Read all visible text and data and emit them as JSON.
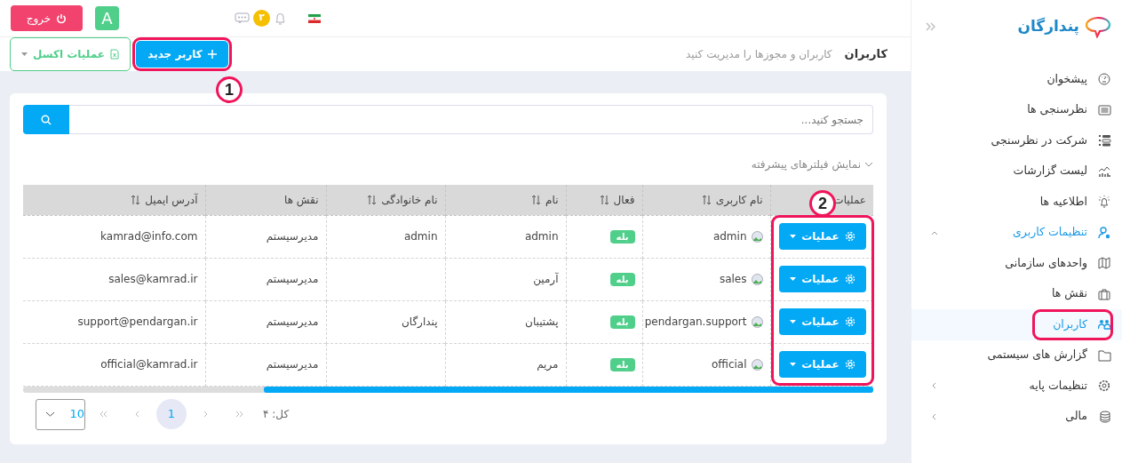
{
  "topbar": {
    "logout": "خروج",
    "avatar": "A",
    "notification_count": "۲"
  },
  "header": {
    "title": "کاربران",
    "subtitle": "کاربران و مجوزها را مدیریت کنید",
    "buttons": [
      {
        "label": "کاربر جدید",
        "kind": "primary"
      },
      {
        "label": "عملیات اکسل",
        "kind": "excel"
      }
    ]
  },
  "search": {
    "placeholder": "جستجو کنید..."
  },
  "filters_toggle": {
    "label": "نمایش فیلترهای پیشرفته",
    "expanded": false
  },
  "table": {
    "columns": [
      {
        "label": "عملیات"
      },
      {
        "label": "نام کاربری",
        "sortable": true
      },
      {
        "label": "فعال",
        "sortable": true
      },
      {
        "label": "نام",
        "sortable": true
      },
      {
        "label": "نام خانوادگی",
        "sortable": true
      },
      {
        "label": "نقش ها",
        "sortable": false
      },
      {
        "label": "آدرس ایمیل",
        "sortable": true
      }
    ],
    "rows": [
      {
        "actions": "عملیات",
        "username": "admin",
        "active": "بله",
        "first_name": "admin",
        "last_name": "admin",
        "roles": "مدیرسیستم",
        "email": "kamrad@info.com"
      },
      {
        "actions": "عملیات",
        "username": "sales",
        "active": "بله",
        "first_name": "آرمین",
        "roles": "مدیرسیستم",
        "email": "sales@kamrad.ir"
      },
      {
        "actions": "عملیات",
        "username": "pendargan.support",
        "active": "بله",
        "first_name": "پشتیبان",
        "last_name": "پندارگان",
        "roles": "مدیرسیستم",
        "email": "support@pendargan.ir"
      },
      {
        "actions": "عملیات",
        "username": "official",
        "active": "بله",
        "first_name": "مریم",
        "roles": "مدیرسیستم",
        "email": "official@kamrad.ir"
      }
    ]
  },
  "pagination": {
    "total": "کل: ۴",
    "pages": [
      {
        "label": "1",
        "selected": true
      }
    ],
    "page_size": "10"
  },
  "sidebar": {
    "logo": "پندارگان",
    "items": [
      {
        "label": "پیشخوان",
        "selected": false
      },
      {
        "label": "نظرسنجی ها",
        "selected": false
      },
      {
        "label": "شرکت در نظرسنجی",
        "selected": false
      },
      {
        "label": "لیست گزارشات",
        "selected": false
      },
      {
        "label": "اطلاعیه ها",
        "selected": false
      },
      {
        "label": "تنظیمات کاربری",
        "selected": false,
        "expanded": true,
        "children": [
          {
            "label": "واحدهای سازمانی",
            "selected": false
          },
          {
            "label": "نقش ها",
            "selected": false
          },
          {
            "label": "کاربران",
            "selected": true
          },
          {
            "label": "گزارش های سیستمی",
            "selected": false
          }
        ]
      },
      {
        "label": "تنظیمات پایه",
        "selected": false,
        "expanded": false
      },
      {
        "label": "مالی",
        "selected": false,
        "expanded": false
      }
    ]
  },
  "annotations": [
    {
      "kind": "new-user",
      "label": "1"
    },
    {
      "kind": "actions",
      "label": "2"
    },
    {
      "kind": "sidebar-selected"
    }
  ]
}
